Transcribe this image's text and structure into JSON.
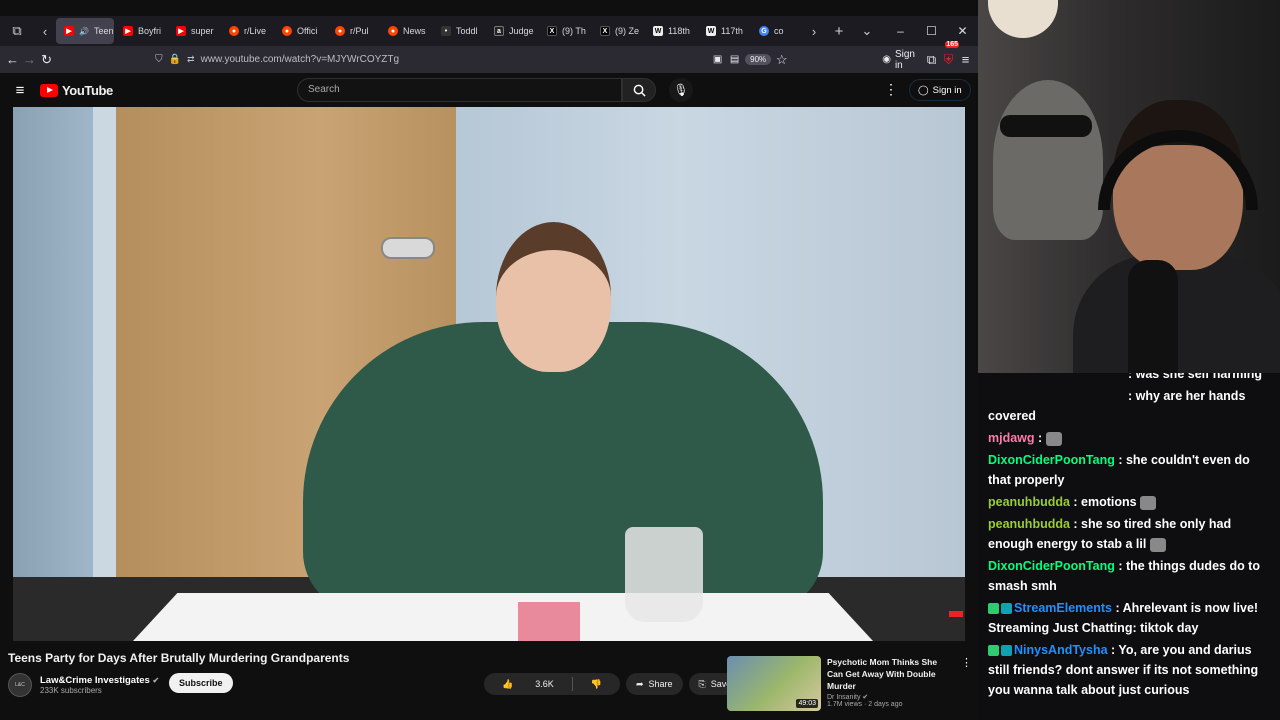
{
  "browser": {
    "tabs": [
      {
        "label": "Teen",
        "favicon": "youtube",
        "active": true
      },
      {
        "label": "Boyfri",
        "favicon": "youtube"
      },
      {
        "label": "super",
        "favicon": "youtube"
      },
      {
        "label": "r/Live",
        "favicon": "reddit"
      },
      {
        "label": "Offici",
        "favicon": "reddit"
      },
      {
        "label": "r/Pul",
        "favicon": "reddit"
      },
      {
        "label": "News",
        "favicon": "reddit"
      },
      {
        "label": "Toddl",
        "favicon": "generic"
      },
      {
        "label": "Judge",
        "favicon": "abc"
      },
      {
        "label": "(9) Th",
        "favicon": "x"
      },
      {
        "label": "(9) Ze",
        "favicon": "x"
      },
      {
        "label": "118th",
        "favicon": "wikipedia"
      },
      {
        "label": "117th",
        "favicon": "wikipedia"
      },
      {
        "label": "co",
        "favicon": "google"
      }
    ],
    "url": "www.youtube.com/watch?v=MJYWrCOYZTg",
    "zoom": "90%",
    "signin_label": "Sign in",
    "extension_badge": "165"
  },
  "youtube": {
    "logo_text": "YouTube",
    "search_placeholder": "Search",
    "signin_label": "Sign in",
    "video_title": "Teens Party for Days After Brutally Murdering Grandparents",
    "channel_name": "Law&Crime Investigates",
    "subscribers": "233K subscribers",
    "subscribe_label": "Subscribe",
    "likes": "3.6K",
    "share_label": "Share",
    "save_label": "Save",
    "recommended": {
      "title": "Psychotic Mom Thinks She Can Get Away With Double Murder",
      "channel": "Dr Insanity",
      "meta": "1.7M views · 2 days ago",
      "duration": "49:03"
    }
  },
  "chat": {
    "messages": [
      {
        "user": "",
        "color": "#ffffff",
        "text": ": was she self harming"
      },
      {
        "user": "",
        "color": "#ffffff",
        "text": ": why are her hands covered"
      },
      {
        "user": "mjdawg",
        "color": "#ff7aa8",
        "text": " : ",
        "emote": true
      },
      {
        "user": "DixonCiderPoonTang",
        "color": "#00ff7f",
        "text": " : she couldn't even do that properly"
      },
      {
        "user": "peanuhbudda",
        "color": "#9acd32",
        "text": " : emotions ",
        "emote": true
      },
      {
        "user": "peanuhbudda",
        "color": "#9acd32",
        "text": " : she so tired she only had enough energy to stab a lil ",
        "emote": true
      },
      {
        "user": "DixonCiderPoonTang",
        "color": "#00ff7f",
        "text": " : the things dudes do to smash smh"
      },
      {
        "user": "StreamElements",
        "color": "#1e90ff",
        "text": " : Ahrelevant is now live! Streaming Just Chatting: tiktok day",
        "badges": true
      },
      {
        "user": "NinysAndTysha",
        "color": "#1e90ff",
        "text": " : Yo, are you and darius still friends? dont answer if its not something you wanna talk about just curious",
        "badges": true
      }
    ]
  }
}
